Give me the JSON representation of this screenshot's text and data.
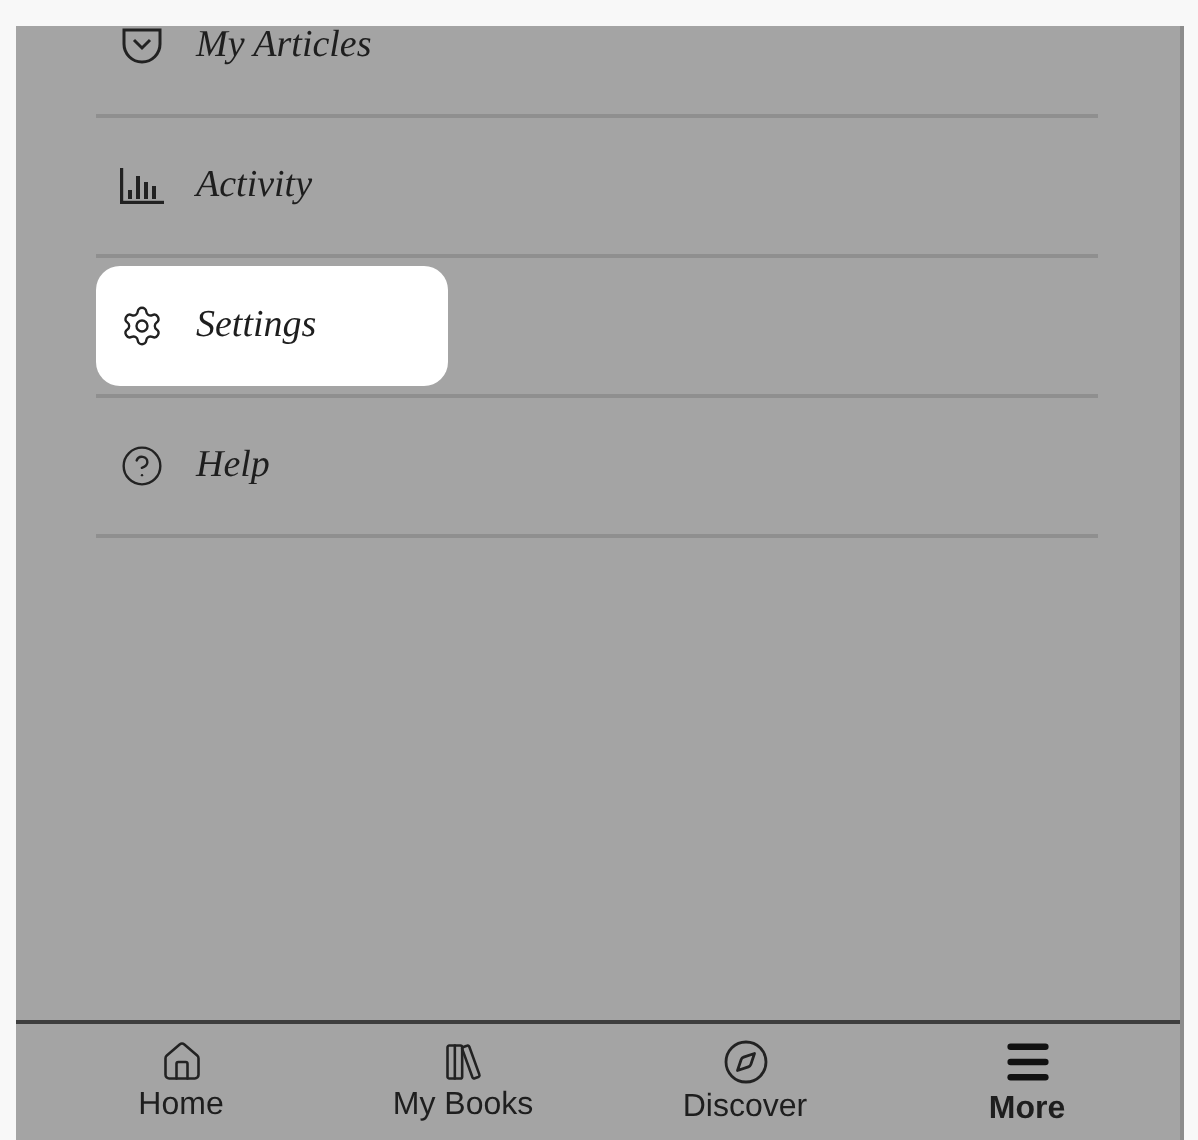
{
  "menu": [
    {
      "label": "My Articles",
      "selected": false
    },
    {
      "label": "Activity",
      "selected": false
    },
    {
      "label": "Settings",
      "selected": true
    },
    {
      "label": "Help",
      "selected": false
    }
  ],
  "bottom_nav": [
    {
      "label": "Home",
      "selected": false
    },
    {
      "label": "My Books",
      "selected": false
    },
    {
      "label": "Discover",
      "selected": false
    },
    {
      "label": "More",
      "selected": true
    }
  ]
}
